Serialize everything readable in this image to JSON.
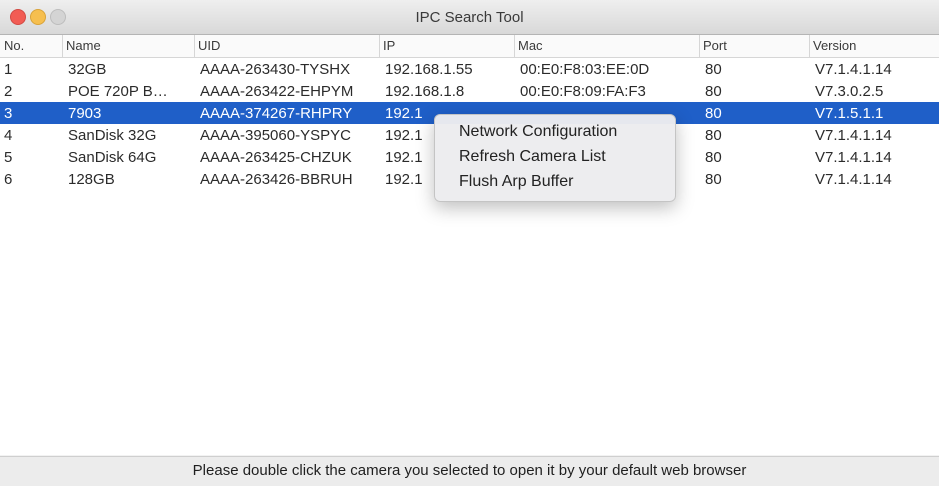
{
  "window": {
    "title": "IPC Search Tool"
  },
  "table": {
    "columns": [
      "No.",
      "Name",
      "UID",
      "IP",
      "Mac",
      "Port",
      "Version"
    ],
    "rows": [
      {
        "no": "1",
        "name": "32GB",
        "uid": "AAAA-263430-TYSHX",
        "ip": "192.168.1.55",
        "mac": "00:E0:F8:03:EE:0D",
        "port": "80",
        "version": "V7.1.4.1.14"
      },
      {
        "no": "2",
        "name": "POE 720P B…",
        "uid": "AAAA-263422-EHPYM",
        "ip": "192.168.1.8",
        "mac": "00:E0:F8:09:FA:F3",
        "port": "80",
        "version": "V7.3.0.2.5"
      },
      {
        "no": "3",
        "name": "7903",
        "uid": "AAAA-374267-RHPRY",
        "ip": "192.1",
        "mac": "",
        "port": "80",
        "version": "V7.1.5.1.1"
      },
      {
        "no": "4",
        "name": "SanDisk 32G",
        "uid": "AAAA-395060-YSPYC",
        "ip": "192.1",
        "mac": "",
        "port": "80",
        "version": "V7.1.4.1.14"
      },
      {
        "no": "5",
        "name": "SanDisk 64G",
        "uid": "AAAA-263425-CHZUK",
        "ip": "192.1",
        "mac": "",
        "port": "80",
        "version": "V7.1.4.1.14"
      },
      {
        "no": "6",
        "name": "128GB",
        "uid": "AAAA-263426-BBRUH",
        "ip": "192.1",
        "mac": "",
        "port": "80",
        "version": "V7.1.4.1.14"
      }
    ],
    "selected_row": 3
  },
  "context_menu": {
    "items": [
      "Network Configuration",
      "Refresh Camera List",
      "Flush Arp Buffer"
    ]
  },
  "status": {
    "text": "Please double click the camera you selected to open it by your default web browser"
  },
  "colors": {
    "selection": "#1f5fc8",
    "close": "#f25c54",
    "minimize": "#f6bf4f",
    "maximize": "#d4d4d4"
  }
}
